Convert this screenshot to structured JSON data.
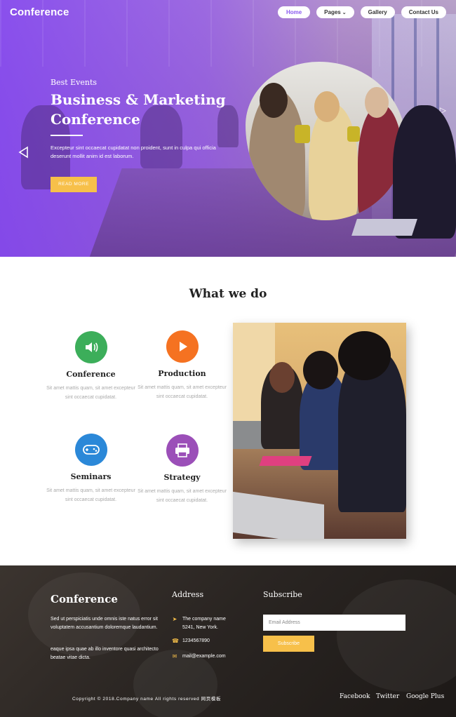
{
  "header": {
    "logo": "Conference",
    "nav": [
      {
        "label": "Home",
        "active": true
      },
      {
        "label": "Pages",
        "has_dropdown": true
      },
      {
        "label": "Gallery"
      },
      {
        "label": "Contact Us"
      }
    ]
  },
  "hero": {
    "kicker": "Best Events",
    "title": "Business & Marketing Conference",
    "description": "Excepteur sint occaecat cupidatat non proident, sunt in culpa qui officia deserunt mollit anim id est laborum.",
    "button": "READ MORE"
  },
  "services": {
    "title": "What we do",
    "items": [
      {
        "title": "Conference",
        "description": "Sit amet mattis quam, sit amet excepteur sint occaecat cupidatat.",
        "icon": "speaker-icon",
        "color": "#3cae5a"
      },
      {
        "title": "Production",
        "description": "Sit amet mattis quam, sit amet excepteur sint occaecat cupidatat.",
        "icon": "play-icon",
        "color": "#f57221"
      },
      {
        "title": "Seminars",
        "description": "Sit amet mattis quam, sit amet excepteur sint occaecat cupidatat.",
        "icon": "gamepad-icon",
        "color": "#2b88d8"
      },
      {
        "title": "Strategy",
        "description": "Sit amet mattis quam, sit amet excepteur sint occaecat cupidatat.",
        "icon": "printer-icon",
        "color": "#9b4fb8"
      }
    ]
  },
  "footer": {
    "logo": "Conference",
    "about_1": "Sed ut perspiciatis unde omnis iste natus error sit voluptatem accusantium doloremque laudantium.",
    "about_2": "eaque ipsa quae ab illo inventore quasi architecto beatae vitae dicta.",
    "address_title": "Address",
    "address_line1": "The company name",
    "address_line2": "5241, New York.",
    "phone": "1234567890",
    "email": "mail@example.com",
    "subscribe_title": "Subscribe",
    "email_placeholder": "Email Address",
    "subscribe_button": "Subscribe",
    "copyright": "Copyright © 2018.Company name All rights reserved 网页模板",
    "social": [
      "Facebook",
      "Twitter",
      "Google Plus"
    ]
  },
  "colors": {
    "accent": "#8c5cf0",
    "button_yellow": "#f7c04a"
  }
}
